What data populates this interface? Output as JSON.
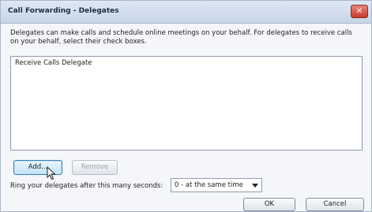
{
  "window": {
    "title": "Call Forwarding - Delegates",
    "close_glyph": "✕"
  },
  "description": "Delegates can make calls and schedule online meetings on your behalf. For delegates to receive calls on your behalf, select their check boxes.",
  "list": {
    "columns": [
      "Receive Calls",
      "Delegate"
    ],
    "rows": []
  },
  "buttons": {
    "add": "Add...",
    "remove": "Remove",
    "ok": "OK",
    "cancel": "Cancel"
  },
  "ring": {
    "label": "Ring your delegates after this many seconds:",
    "selected": "0 - at the same time"
  },
  "icons": {
    "cursor": "mouse-pointer-icon",
    "close": "close-icon",
    "dropdown": "chevron-down-icon"
  }
}
